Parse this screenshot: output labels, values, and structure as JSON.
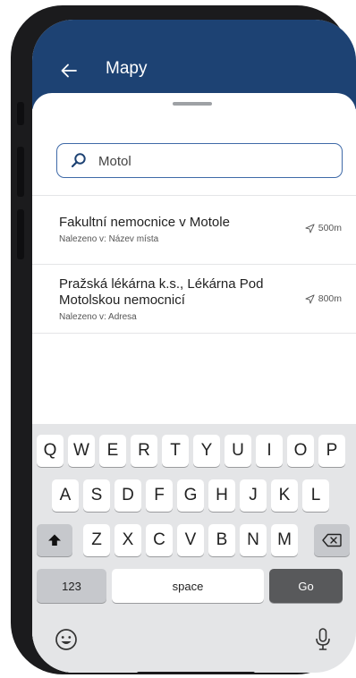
{
  "app_bar": {
    "title": "Mapy",
    "back_icon": "arrow-left-icon"
  },
  "search": {
    "value": "Motol",
    "icon": "search-icon"
  },
  "results": [
    {
      "title": "Fakultní nemocnice v Motole",
      "subtitle": "Nalezeno v: Název místa",
      "distance": "500m"
    },
    {
      "title": "Pražská lékárna k.s., Lékárna Pod Motolskou nemocnicí",
      "subtitle": "Nalezeno v: Adresa",
      "distance": "800m"
    }
  ],
  "keyboard": {
    "row1": [
      "Q",
      "W",
      "E",
      "R",
      "T",
      "Y",
      "U",
      "I",
      "O",
      "P"
    ],
    "row2": [
      "A",
      "S",
      "D",
      "F",
      "G",
      "H",
      "J",
      "K",
      "L"
    ],
    "row3": [
      "Z",
      "X",
      "C",
      "V",
      "B",
      "N",
      "M"
    ],
    "numbers_label": "123",
    "space_label": "space",
    "go_label": "Go"
  },
  "colors": {
    "app_bar": "#1d4273",
    "search_border": "#3f6aa8",
    "go_key": "#58595b"
  }
}
